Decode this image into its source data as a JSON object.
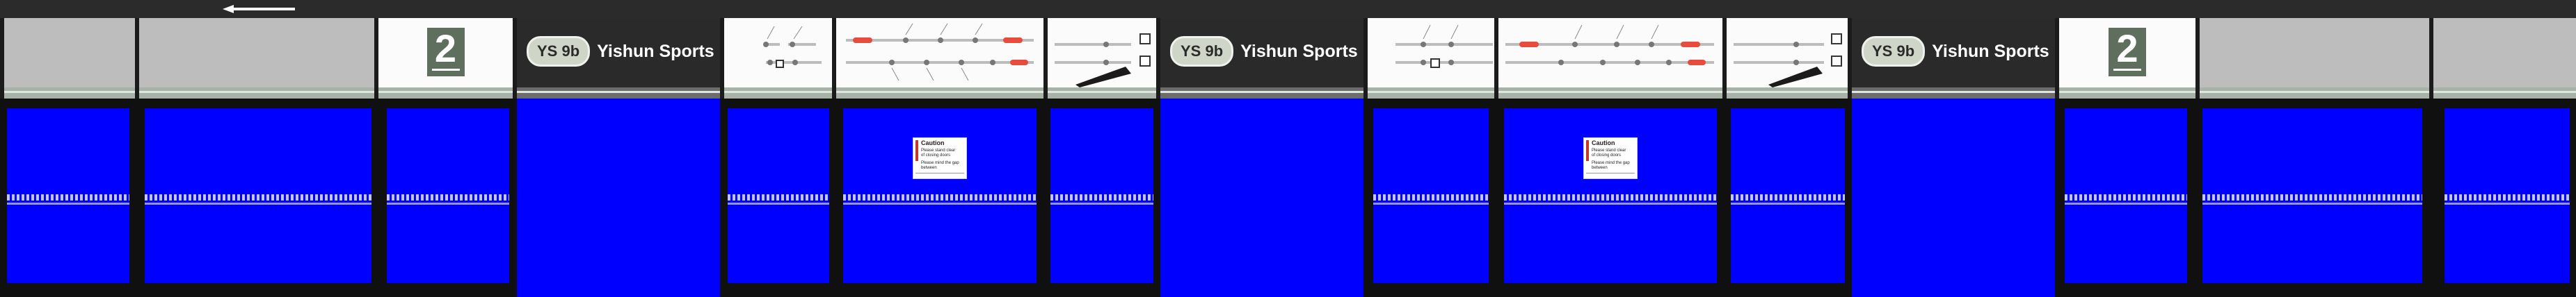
{
  "navigation": {
    "direction_arrow": "left-arrow-icon"
  },
  "platform": {
    "number": "2"
  },
  "station": {
    "code": "YS 9b",
    "name": "Yishun Sports Hall"
  },
  "caution_sign": {
    "title": "Caution",
    "line1": "Please stand clear of closing doors",
    "line2": "Please mind the gap between"
  },
  "colors": {
    "door_blue": "#0000ff",
    "platform_green": "#5e6f5e",
    "line_grey": "#bcbcbc",
    "current_red": "#e74c3c",
    "station_dark": "#2a2a2a"
  }
}
